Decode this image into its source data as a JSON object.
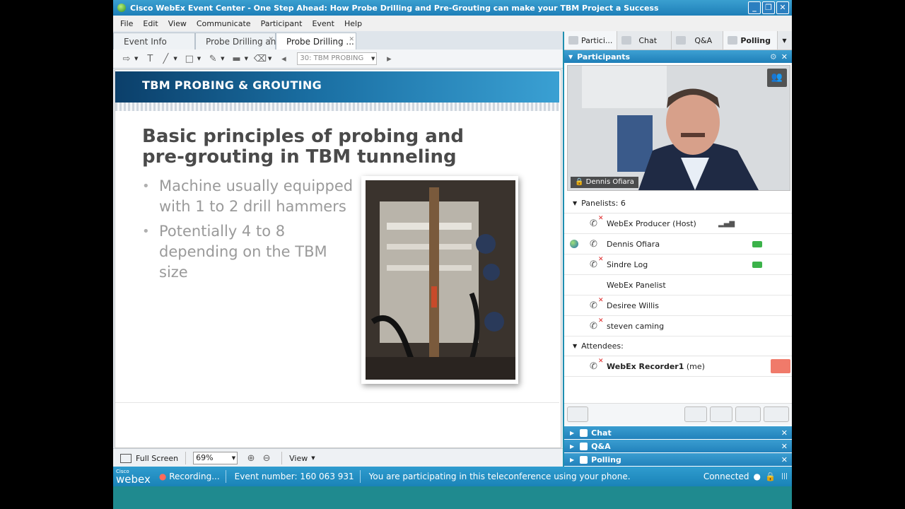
{
  "window": {
    "title": "Cisco WebEx Event Center - One Step Ahead: How Probe Drilling and Pre-Grouting can make your TBM Project a Success"
  },
  "menu": [
    "File",
    "Edit",
    "View",
    "Communicate",
    "Participant",
    "Event",
    "Help"
  ],
  "doc_tabs": [
    {
      "label": "Event Info"
    },
    {
      "label": "Probe Drilling an..."
    },
    {
      "label": "Probe Drilling ..."
    }
  ],
  "toolbar": {
    "page_select": "30: TBM PROBING"
  },
  "slide": {
    "banner": "TBM PROBING & GROUTING",
    "heading_line1": "Basic principles of probing and",
    "heading_line2": "pre-grouting in TBM tunneling",
    "bullets": [
      "Machine usually equipped with 1 to 2 drill hammers",
      "Potentially 4 to 8 depending on the TBM size"
    ]
  },
  "bottom": {
    "fullscreen": "Full Screen",
    "zoom": "69%",
    "view": "View"
  },
  "right_tabs": [
    "Partici...",
    "Chat",
    "Q&A",
    "Polling"
  ],
  "participants": {
    "title": "Participants",
    "video_label": "Dennis Ofiara",
    "panelists_header": "Panelists: 6",
    "panelists": [
      {
        "name": "WebEx Producer (Host)"
      },
      {
        "name": "Dennis Ofiara"
      },
      {
        "name": "Sindre Log"
      },
      {
        "name": "WebEx Panelist"
      },
      {
        "name": "Desiree Willis"
      },
      {
        "name": "steven caming"
      }
    ],
    "attendees_header": "Attendees:",
    "attendees": [
      {
        "name": "WebEx Recorder1",
        "suffix": "(me)"
      }
    ]
  },
  "bottom_panels": [
    "Chat",
    "Q&A",
    "Polling"
  ],
  "status": {
    "logo_top": "Cisco",
    "logo": "webex",
    "recording": "Recording...",
    "event_number": "Event number: 160 063 931",
    "message": "You are participating in this teleconference using your phone.",
    "connected": "Connected"
  }
}
